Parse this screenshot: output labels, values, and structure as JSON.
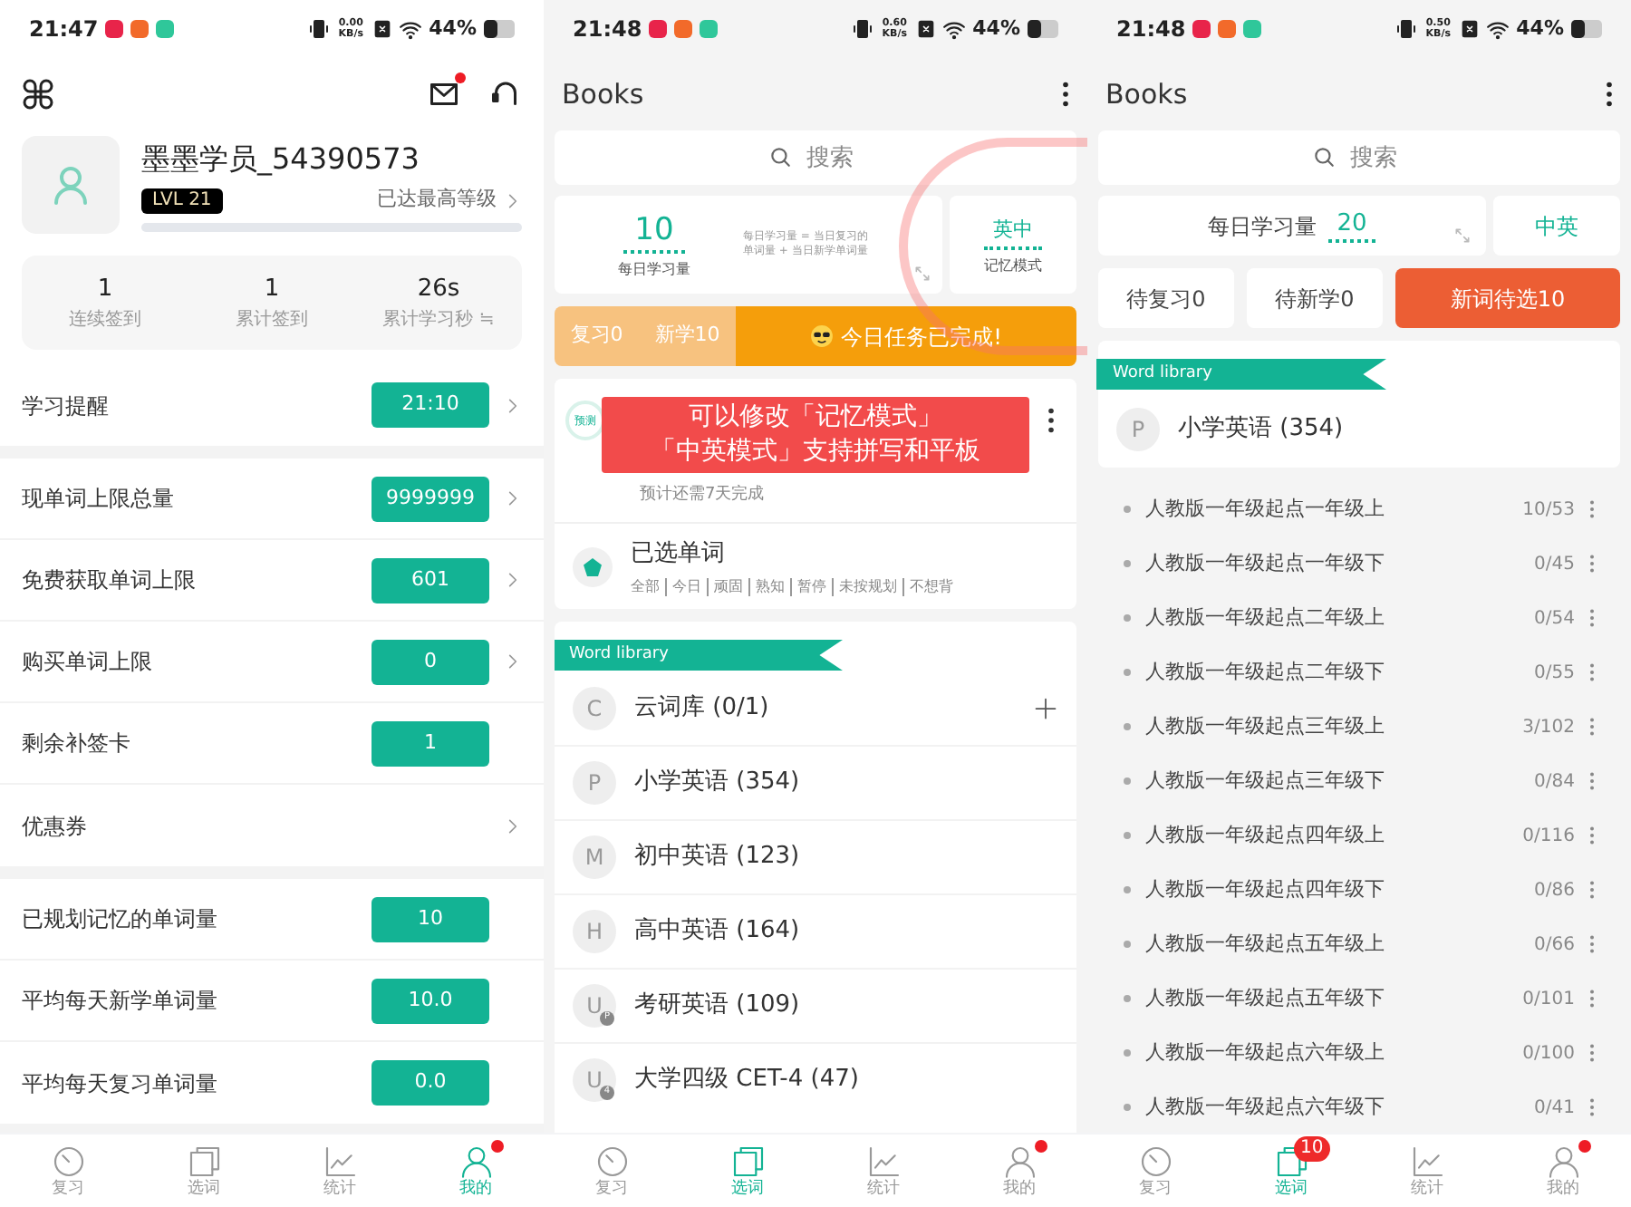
{
  "profile_screen": {
    "status_bar": {
      "time": "21:47",
      "net_speed": "0.00 KB/s",
      "battery": "44%"
    },
    "mail_unread": true,
    "user": {
      "name": "墨墨学员_54390573",
      "level_badge": "LVL 21",
      "level_note": "已达最高等级",
      "level": 0
    },
    "stats": [
      {
        "value": "1",
        "label": "连续签到"
      },
      {
        "value": "1",
        "label": "累计签到"
      },
      {
        "value": "26s",
        "label": "累计学习秒 ≒"
      }
    ],
    "sections": [
      [
        {
          "label": "学习提醒",
          "value": "21:10",
          "chevron": true
        }
      ],
      [
        {
          "label": "现单词上限总量",
          "value": "9999999",
          "chevron": true
        },
        {
          "label": "免费获取单词上限",
          "value": "601",
          "chevron": true
        },
        {
          "label": "购买单词上限",
          "value": "0",
          "chevron": true
        },
        {
          "label": "剩余补签卡",
          "value": "1",
          "chevron": false
        },
        {
          "label": "优惠券",
          "chevron": true
        }
      ],
      [
        {
          "label": "已规划记忆的单词量",
          "value": "10",
          "chevron": false
        },
        {
          "label": "平均每天新学单词量",
          "value": "10.0",
          "chevron": false
        },
        {
          "label": "平均每天复习单词量",
          "value": "0.0",
          "chevron": false
        }
      ]
    ],
    "tab_bar": [
      {
        "label": "复习",
        "selected": false,
        "dot": false
      },
      {
        "label": "选词",
        "selected": false,
        "dot": false
      },
      {
        "label": "统计",
        "selected": false,
        "dot": false
      },
      {
        "label": "我的",
        "selected": true,
        "dot": true
      }
    ]
  },
  "books_screen": {
    "status_bar": {
      "time": "21:48",
      "net_speed": "0.60 KB/s",
      "battery": "44%"
    },
    "title": "Books",
    "search": {
      "placeholder": "搜索"
    },
    "daily": {
      "value": "10",
      "label": "每日学习量",
      "note": [
        "每日学习量 = 当日复习的",
        "单词量 + 当日新学单词量"
      ]
    },
    "mode": {
      "value": "英中",
      "label": "记忆模式"
    },
    "task_bar": {
      "review": "复习0",
      "new": "新学10",
      "status": "今日任务已完成!"
    },
    "current_book": {
      "badge": "预测",
      "eta": "预计还需7天完成"
    },
    "callout": [
      "可以修改「记忆模式」",
      "「中英模式」支持拼写和平板"
    ],
    "selected_words": {
      "title": "已选单词",
      "filters": [
        "全部",
        "今日",
        "顽固",
        "熟知",
        "暂停",
        "未按规划",
        "不想背"
      ]
    },
    "library": {
      "ribbon": "Word library",
      "items": [
        {
          "letter": "C",
          "name": "云词库 (0/1)",
          "add": true
        },
        {
          "letter": "P",
          "name": "小学英语 (354)",
          "add": false
        },
        {
          "letter": "M",
          "name": "初中英语 (123)",
          "add": false
        },
        {
          "letter": "H",
          "name": "高中英语 (164)",
          "add": false
        },
        {
          "letter": "U",
          "name": "考研英语 (109)",
          "add": false,
          "sub_badge": "P"
        },
        {
          "letter": "U",
          "name": "大学四级 CET-4 (47)",
          "add": false,
          "sub_badge": "4"
        }
      ]
    },
    "tab_bar": [
      {
        "label": "复习",
        "selected": false,
        "dot": false
      },
      {
        "label": "选词",
        "selected": true,
        "dot": false
      },
      {
        "label": "统计",
        "selected": false,
        "dot": false
      },
      {
        "label": "我的",
        "selected": false,
        "dot": true
      }
    ]
  },
  "library_screen": {
    "status_bar": {
      "time": "21:48",
      "net_speed": "0.50 KB/s",
      "battery": "44%"
    },
    "title": "Books",
    "search": {
      "placeholder": "搜索"
    },
    "daily": {
      "label": "每日学习量",
      "value": "20"
    },
    "mode": "中英",
    "counters": [
      {
        "label": "待复习0",
        "highlight": false
      },
      {
        "label": "待新学0",
        "highlight": false
      },
      {
        "label": "新词待选10",
        "highlight": true
      }
    ],
    "library": {
      "ribbon": "Word library",
      "letter": "P",
      "name": "小学英语 (354)"
    },
    "units": [
      {
        "name": "人教版一年级起点一年级上",
        "progress": "10/53"
      },
      {
        "name": "人教版一年级起点一年级下",
        "progress": "0/45"
      },
      {
        "name": "人教版一年级起点二年级上",
        "progress": "0/54"
      },
      {
        "name": "人教版一年级起点二年级下",
        "progress": "0/55"
      },
      {
        "name": "人教版一年级起点三年级上",
        "progress": "3/102"
      },
      {
        "name": "人教版一年级起点三年级下",
        "progress": "0/84"
      },
      {
        "name": "人教版一年级起点四年级上",
        "progress": "0/116"
      },
      {
        "name": "人教版一年级起点四年级下",
        "progress": "0/86"
      },
      {
        "name": "人教版一年级起点五年级上",
        "progress": "0/66"
      },
      {
        "name": "人教版一年级起点五年级下",
        "progress": "0/101"
      },
      {
        "name": "人教版一年级起点六年级上",
        "progress": "0/100"
      },
      {
        "name": "人教版一年级起点六年级下",
        "progress": "0/41"
      }
    ],
    "tab_bar": [
      {
        "label": "复习",
        "selected": false,
        "dot": false
      },
      {
        "label": "选词",
        "selected": true,
        "dot": false,
        "badge": "10"
      },
      {
        "label": "统计",
        "selected": false,
        "dot": false
      },
      {
        "label": "我的",
        "selected": false,
        "dot": true
      }
    ]
  }
}
